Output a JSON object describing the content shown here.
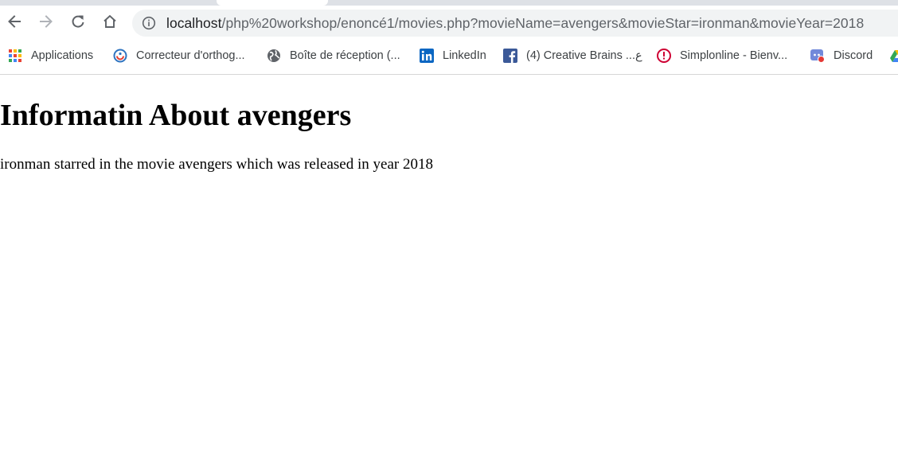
{
  "browser": {
    "address_bar": {
      "url_host": "localhost",
      "url_path": "/php%20workshop/enoncé1/movies.php?movieName=avengers&movieStar=ironman&movieYear=2018"
    },
    "nav_icons": [
      "back-arrow-icon",
      "forward-arrow-icon",
      "reload-icon",
      "home-icon",
      "info-icon"
    ],
    "bookmarks": [
      {
        "label": "Applications",
        "icon": "apps-grid-icon"
      },
      {
        "label": "Correcteur d'orthog...",
        "icon": "spellcheck-icon"
      },
      {
        "label": "Boîte de réception (...",
        "icon": "globe-icon"
      },
      {
        "label": "LinkedIn",
        "icon": "linkedin-icon",
        "color": "#0a66c2"
      },
      {
        "label": "(4) Creative Brains ...ع",
        "icon": "facebook-icon",
        "color": "#3b5998"
      },
      {
        "label": "Simplonline - Bienv...",
        "icon": "simplonline-icon",
        "color": "#ce0033"
      },
      {
        "label": "Discord",
        "icon": "discord-icon",
        "color": "#7289da"
      }
    ]
  },
  "page": {
    "heading": "Informatin About avengers",
    "paragraph": "ironman starred in the movie avengers which was released in year 2018"
  }
}
